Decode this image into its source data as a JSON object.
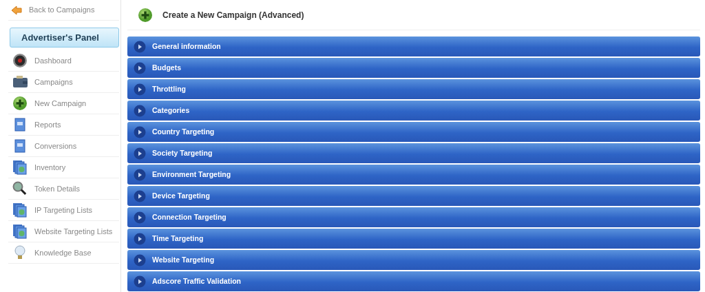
{
  "sidebar": {
    "back_link": "Back to Campaigns",
    "panel_title": "Advertiser's Panel",
    "items": [
      {
        "label": "Dashboard",
        "kind": "gauge"
      },
      {
        "label": "Campaigns",
        "kind": "wallet"
      },
      {
        "label": "New Campaign",
        "kind": "plus"
      },
      {
        "label": "Reports",
        "kind": "document"
      },
      {
        "label": "Conversions",
        "kind": "document"
      },
      {
        "label": "Inventory",
        "kind": "stack"
      },
      {
        "label": "Token Details",
        "kind": "magnifier"
      },
      {
        "label": "IP Targeting Lists",
        "kind": "stack"
      },
      {
        "label": "Website Targeting Lists",
        "kind": "stack"
      },
      {
        "label": "Knowledge Base",
        "kind": "bulb"
      }
    ]
  },
  "page_title": "Create a New Campaign (Advanced)",
  "sections": [
    "General information",
    "Budgets",
    "Throttling",
    "Categories",
    "Country Targeting",
    "Society Targeting",
    "Environment Targeting",
    "Device Targeting",
    "Connection Targeting",
    "Time Targeting",
    "Website Targeting",
    "Adscore Traffic Validation"
  ]
}
